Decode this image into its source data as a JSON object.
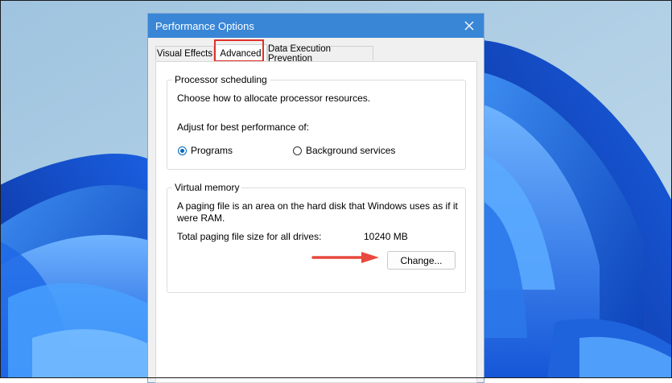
{
  "window": {
    "title": "Performance Options"
  },
  "tabs": [
    {
      "label": "Visual Effects",
      "selected": false
    },
    {
      "label": "Advanced",
      "selected": true
    },
    {
      "label": "Data Execution Prevention",
      "selected": false
    }
  ],
  "processor_scheduling": {
    "title": "Processor scheduling",
    "description": "Choose how to allocate processor resources.",
    "adjust_label": "Adjust for best performance of:",
    "options": [
      {
        "label": "Programs",
        "checked": true
      },
      {
        "label": "Background services",
        "checked": false
      }
    ]
  },
  "virtual_memory": {
    "title": "Virtual memory",
    "description_line1": "A paging file is an area on the hard disk that Windows uses as if it",
    "description_line2": "were RAM.",
    "total_label": "Total paging file size for all drives:",
    "total_value": "10240 MB",
    "change_button": "Change..."
  },
  "colors": {
    "titlebar": "#3a86d6",
    "highlight": "#e0322a",
    "arrow": "#e8483e",
    "radio_accent": "#0067c0"
  }
}
